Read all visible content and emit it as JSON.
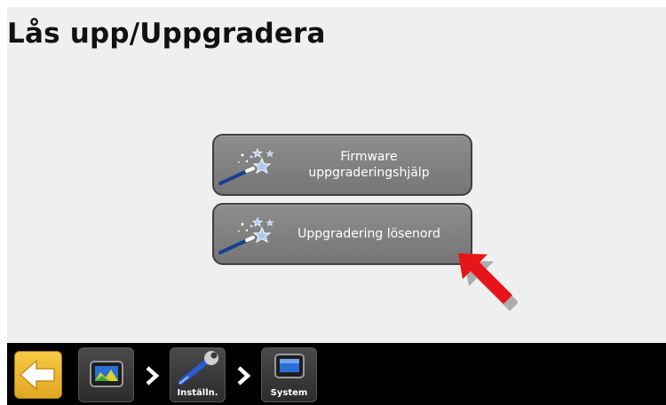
{
  "page": {
    "title": "Lås upp/Uppgradera"
  },
  "buttons": [
    {
      "line1": "Firmware",
      "line2": "uppgraderingshjälp",
      "icon": "magic-wand-icon"
    },
    {
      "line1": "Uppgradering lösenord",
      "icon": "magic-wand-icon"
    }
  ],
  "taskbar": {
    "back": {
      "icon": "back-arrow-icon"
    },
    "home": {
      "icon": "display-terminal-icon"
    },
    "settings": {
      "label": "Inställn.",
      "icon": "wrench-icon"
    },
    "system": {
      "label": "System",
      "icon": "display-terminal-icon"
    }
  },
  "colors": {
    "accent_arrow": "#e8141a",
    "back_button": "#f0b82e",
    "button_gray": "#828282"
  }
}
